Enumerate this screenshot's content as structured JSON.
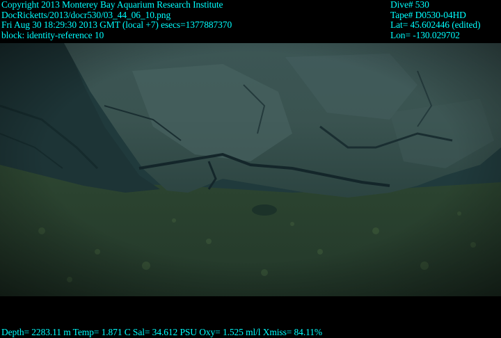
{
  "header_left": {
    "line1": "Copyright 2013 Monterey Bay Aquarium Research Institute",
    "line2": "DocRicketts/2013/docr530/03_44_06_10.png",
    "line3": "Fri Aug 30 18:29:30 2013 GMT (local +7)  esecs=1377887370",
    "line4": "block: identity-reference 10"
  },
  "header_right": {
    "dive": "Dive# 530",
    "tape": "Tape# D0530-04HD",
    "lat": "Lat= 45.602446 (edited)",
    "lon": "Lon= -130.029702"
  },
  "footer": {
    "telemetry": "Depth= 2283.11 m  Temp= 1.871 C  Sal= 34.612 PSU  Oxy= 1.525 ml/l  Xmiss= 84.11%"
  },
  "colors": {
    "overlay_text": "#00ffff",
    "background": "#000000"
  }
}
